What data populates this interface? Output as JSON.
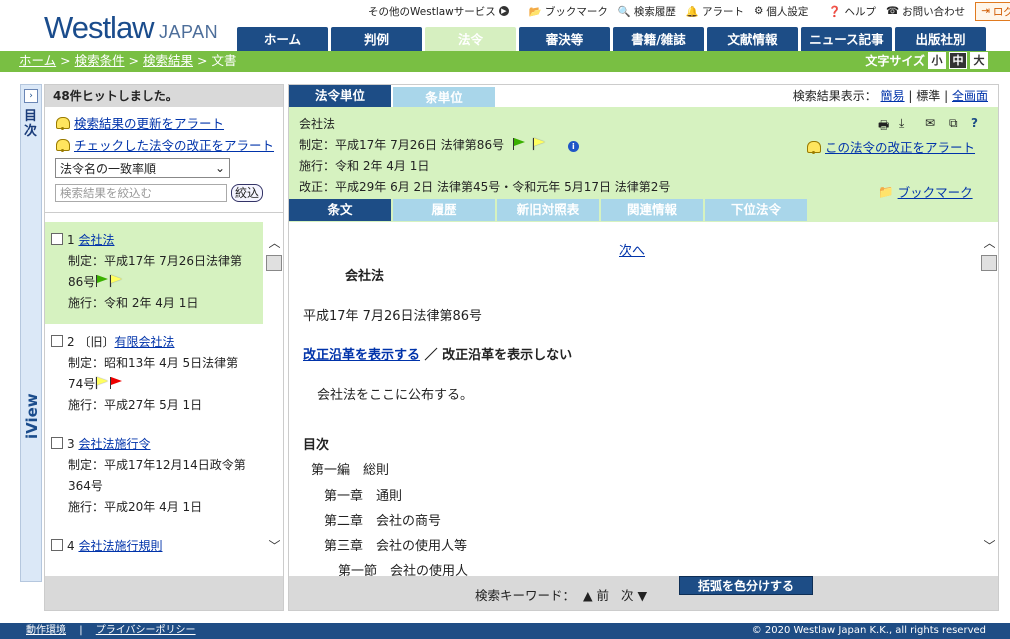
{
  "logo": {
    "main": "Westlaw",
    "sub": "JAPAN"
  },
  "utility": {
    "other_services": "その他のWestlawサービス",
    "bookmark": "ブックマーク",
    "search_history": "検索履歴",
    "alert": "アラート",
    "personal": "個人設定",
    "help": "ヘルプ",
    "contact": "お問い合わせ",
    "logout": "ログアウト"
  },
  "main_tabs": [
    {
      "label": "ホーム"
    },
    {
      "label": "判例"
    },
    {
      "label": "法令"
    },
    {
      "label": "審決等"
    },
    {
      "label": "書籍/雑誌"
    },
    {
      "label": "文献情報"
    },
    {
      "label": "ニュース記事"
    },
    {
      "label": "出版社別"
    }
  ],
  "breadcrumb": {
    "home": "ホーム",
    "cond": "検索条件",
    "results": "検索結果",
    "current": "文書",
    "sep": " > "
  },
  "font_size": {
    "label": "文字サイズ",
    "small": "小",
    "medium": "中",
    "large": "大"
  },
  "iview": {
    "toc": "目次",
    "label": "iView",
    "expand": "›"
  },
  "left": {
    "hits": "48件ヒットしました。",
    "alert1": "検索結果の更新をアラート",
    "alert2": "チェックした法令の改正をアラート",
    "sort": "法令名の一致率順",
    "filter_placeholder": "検索結果を絞込む",
    "filter_btn": "絞込",
    "results": [
      {
        "num": "1",
        "prefix": "",
        "title": "会社法",
        "enact": "制定：平成17年 7月26日法律第",
        "enact2": "86号",
        "enforce": "施行：令和 2年 4月 1日"
      },
      {
        "num": "2",
        "prefix": "〔旧〕",
        "title": "有限会社法",
        "enact": "制定：昭和13年 4月 5日法律第",
        "enact2": "74号",
        "enforce": "施行：平成27年 5月 1日"
      },
      {
        "num": "3",
        "prefix": "",
        "title": "会社法施行令",
        "enact": "制定：平成17年12月14日政令第",
        "enact2": "364号",
        "enforce": "施行：平成20年 4月 1日"
      },
      {
        "num": "4",
        "prefix": "",
        "title": "会社法施行規則",
        "enact": "",
        "enact2": "",
        "enforce": ""
      }
    ]
  },
  "main": {
    "unit_tabs": {
      "law": "法令単位",
      "article": "条単位"
    },
    "display": {
      "label": "検索結果表示：",
      "simple": "簡易",
      "standard": "標準",
      "full": "全画面",
      "sep": "|"
    },
    "head": {
      "name": "会社法",
      "enact": "制定：平成17年 7月26日 法律第86号",
      "enforce": "施行：令和 2年 4月 1日",
      "amend": "改正：平成29年 6月 2日 法律第45号・令和元年 5月17日 法律第2号",
      "alert": "この法令の改正をアラート",
      "bookmark": "ブックマーク",
      "info": "i"
    },
    "sub_tabs": [
      {
        "label": "条文"
      },
      {
        "label": "履歴"
      },
      {
        "label": "新旧対照表"
      },
      {
        "label": "関連情報"
      },
      {
        "label": "下位法令"
      }
    ],
    "doc": {
      "next": "次へ",
      "title": "会社法",
      "date": "平成17年 7月26日法律第86号",
      "show_rev": "改正沿革を表示する",
      "slash": " ／ ",
      "hide_rev": "改正沿革を表示しない",
      "promul": "会社法をここに公布する。",
      "toc": "目次",
      "l1": "第一編　総則",
      "l2": "第一章　通則",
      "l3": "第二章　会社の商号",
      "l4": "第三章　会社の使用人等",
      "l5": "第一節　会社の使用人"
    },
    "footer": {
      "keyword": "検索キーワード：",
      "prev": "▲ 前",
      "next": "次 ▼",
      "color": "括弧を色分けする"
    }
  },
  "footer": {
    "env": "動作環境",
    "sep": "|",
    "privacy": "プライバシーポリシー",
    "copyright": "© 2020 Westlaw Japan K.K., all rights reserved"
  },
  "colors": {
    "navy": "#1d4d86",
    "green": "#79bf43",
    "light_green": "#d6f2c0",
    "light_blue": "#a9d6ea"
  }
}
